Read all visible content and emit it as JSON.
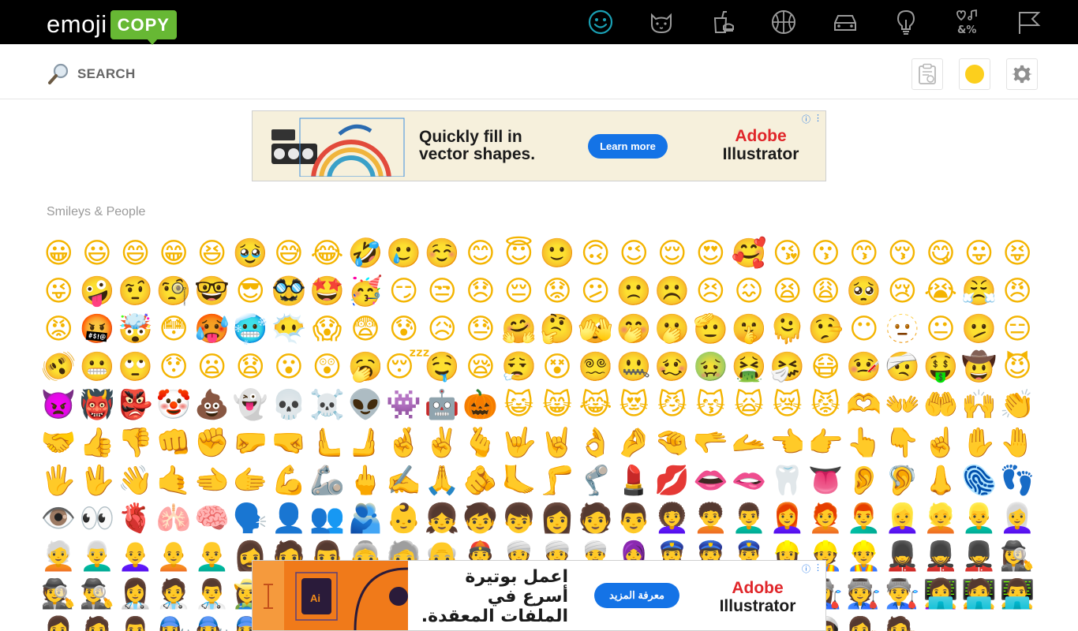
{
  "header": {
    "logo_word": "emoji",
    "logo_badge": "COPY",
    "categories": [
      {
        "icon": "smiley-face-icon",
        "active": true
      },
      {
        "icon": "cat-face-icon",
        "active": false
      },
      {
        "icon": "food-drink-icon",
        "active": false
      },
      {
        "icon": "basketball-icon",
        "active": false
      },
      {
        "icon": "car-icon",
        "active": false
      },
      {
        "icon": "light-bulb-icon",
        "active": false
      },
      {
        "icon": "symbols-icon",
        "active": false
      },
      {
        "icon": "flag-icon",
        "active": false
      }
    ],
    "accent_color": "#1aa0b4"
  },
  "toolbar": {
    "search_placeholder": "SEARCH",
    "clipboard_icon": "clipboard-icon",
    "skin_tone_color": "#fccf1d",
    "settings_icon": "gear-icon"
  },
  "ads": {
    "top": {
      "headline": "Quickly fill in vector shapes.",
      "cta": "Learn more",
      "brand_line1": "Adobe",
      "brand_line2": "Illustrator"
    },
    "bottom": {
      "headline": "اعمل بوتيرة أسرع في الملفات المعقدة.",
      "cta": "معرفة المزيد",
      "brand_line1": "Adobe",
      "brand_line2": "Illustrator"
    }
  },
  "section": {
    "title": "Smileys & People"
  },
  "emojis": [
    "😀",
    "😃",
    "😄",
    "😁",
    "😆",
    "🥹",
    "😅",
    "😂",
    "🤣",
    "🥲",
    "☺️",
    "😊",
    "😇",
    "🙂",
    "🙃",
    "😉",
    "😌",
    "😍",
    "🥰",
    "😘",
    "😗",
    "😙",
    "😚",
    "😋",
    "😛",
    "😝",
    "😜",
    "🤪",
    "🤨",
    "🧐",
    "🤓",
    "😎",
    "🥸",
    "🤩",
    "🥳",
    "😏",
    "😒",
    "😞",
    "😔",
    "😟",
    "😕",
    "🙁",
    "☹️",
    "😣",
    "😖",
    "😫",
    "😩",
    "🥺",
    "😢",
    "😭",
    "😤",
    "😠",
    "😡",
    "🤬",
    "🤯",
    "😳",
    "🥵",
    "🥶",
    "😶‍🌫️",
    "😱",
    "😨",
    "😰",
    "😥",
    "😓",
    "🤗",
    "🤔",
    "🫣",
    "🤭",
    "🫢",
    "🫡",
    "🤫",
    "🫠",
    "🤥",
    "😶",
    "🫥",
    "😐",
    "🫤",
    "😑",
    "🫨",
    "😬",
    "🙄",
    "😯",
    "😦",
    "😧",
    "😮",
    "😲",
    "🥱",
    "😴",
    "🤤",
    "😪",
    "😮‍💨",
    "😵",
    "😵‍💫",
    "🤐",
    "🥴",
    "🤢",
    "🤮",
    "🤧",
    "😷",
    "🤒",
    "🤕",
    "🤑",
    "🤠",
    "😈",
    "👿",
    "👹",
    "👺",
    "🤡",
    "💩",
    "👻",
    "💀",
    "☠️",
    "👽",
    "👾",
    "🤖",
    "🎃",
    "😺",
    "😸",
    "😹",
    "😻",
    "😼",
    "😽",
    "🙀",
    "😿",
    "😾",
    "🫶",
    "👐",
    "🤲",
    "🙌",
    "👏",
    "🤝",
    "👍",
    "👎",
    "👊",
    "✊",
    "🤛",
    "🤜",
    "🫷",
    "🫸",
    "🤞",
    "✌️",
    "🫰",
    "🤟",
    "🤘",
    "👌",
    "🤌",
    "🤏",
    "🫳",
    "🫴",
    "👈",
    "👉",
    "👆",
    "👇",
    "☝️",
    "✋",
    "🤚",
    "🖐️",
    "🖖",
    "👋",
    "🤙",
    "🫲",
    "🫱",
    "💪",
    "🦾",
    "🖕",
    "✍️",
    "🙏",
    "🫵",
    "🦶",
    "🦵",
    "🦿",
    "💄",
    "💋",
    "👄",
    "🫦",
    "🦷",
    "👅",
    "👂",
    "🦻",
    "👃",
    "🫆",
    "👣",
    "👁️",
    "👀",
    "🫀",
    "🫁",
    "🧠",
    "🗣️",
    "👤",
    "👥",
    "🫂",
    "👶",
    "👧",
    "🧒",
    "👦",
    "👩",
    "🧑",
    "👨",
    "👩‍🦱",
    "🧑‍🦱",
    "👨‍🦱",
    "👩‍🦰",
    "🧑‍🦰",
    "👨‍🦰",
    "👱‍♀️",
    "👱",
    "👱‍♂️",
    "👩‍🦳",
    "🧑‍🦳",
    "👨‍🦳",
    "👩‍🦲",
    "🧑‍🦲",
    "👨‍🦲",
    "🧔‍♀️",
    "🧔",
    "🧔‍♂️",
    "👵",
    "🧓",
    "👴",
    "👲",
    "👳‍♀️",
    "👳",
    "👳‍♂️",
    "🧕",
    "👮‍♀️",
    "👮",
    "👮‍♂️",
    "👷‍♀️",
    "👷",
    "👷‍♂️",
    "💂‍♀️",
    "💂",
    "💂‍♂️",
    "🕵️‍♀️",
    "🕵️",
    "🕵️‍♂️",
    "👩‍⚕️",
    "🧑‍⚕️",
    "👨‍⚕️",
    "👩‍🌾",
    "🧑‍🌾",
    "👨‍🌾",
    "👩‍🍳",
    "🧑‍🍳",
    "👨‍🍳",
    "👩‍🎓",
    "🧑‍🎓",
    "👨‍🎓",
    "👩‍🎤",
    "🧑‍🎤",
    "👨‍🎤",
    "👩‍🏫",
    "🧑‍🏫",
    "👨‍🏫",
    "👩‍🏭",
    "🧑‍🏭",
    "👨‍🏭",
    "👩‍💻",
    "🧑‍💻",
    "👨‍💻",
    "👩‍💼",
    "🧑‍💼",
    "👨‍💼",
    "👩‍🔧",
    "🧑‍🔧",
    "👨‍🔧",
    "👩‍🔬",
    "🧑‍🔬",
    "👨‍🔬",
    "👩‍🎨",
    "🧑‍🎨",
    "👨‍🎨",
    "👩‍🚒",
    "🧑‍🚒",
    "👨‍🚒",
    "👩‍✈️",
    "🧑‍✈️",
    "👨‍✈️",
    "👩‍🚀",
    "🧑‍🚀",
    "👨‍🚀",
    "👩‍⚖️",
    "🧑‍⚖️"
  ]
}
